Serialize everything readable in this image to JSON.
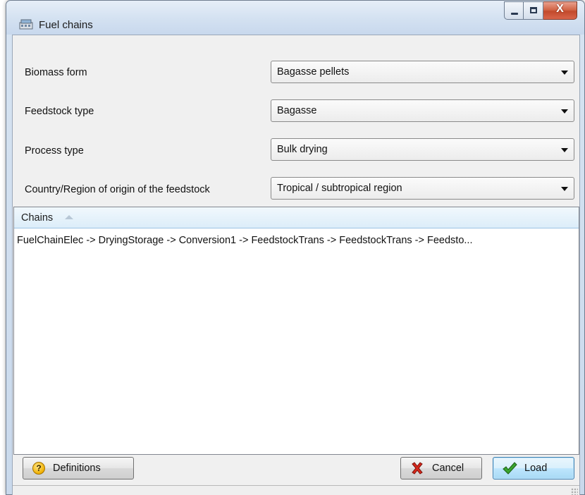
{
  "window": {
    "title": "Fuel chains",
    "icon": "app-window-icon"
  },
  "caption_buttons": {
    "minimize_icon": "minimize-icon",
    "maximize_icon": "maximize-icon",
    "close_glyph": "X"
  },
  "form": {
    "biomass_form": {
      "label": "Biomass form",
      "value": "Bagasse pellets"
    },
    "feedstock_type": {
      "label": "Feedstock type",
      "value": "Bagasse"
    },
    "process_type": {
      "label": "Process type",
      "value": "Bulk drying"
    },
    "origin": {
      "label": "Country/Region of origin of the feedstock",
      "value": "Tropical / subtropical region"
    }
  },
  "chains": {
    "header": "Chains",
    "sort": "ascending",
    "rows": [
      "FuelChainElec -> DryingStorage -> Conversion1 -> FeedstockTrans -> FeedstockTrans -> Feedsto..."
    ]
  },
  "buttons": {
    "definitions": {
      "label": "Definitions",
      "icon": "help-icon"
    },
    "cancel": {
      "label": "Cancel",
      "icon": "cancel-x-icon"
    },
    "load": {
      "label": "Load",
      "icon": "checkmark-icon"
    }
  },
  "colors": {
    "titlebar": "#d3e1f1",
    "close_button": "#c24a2c",
    "default_button": "#bee6fd"
  }
}
